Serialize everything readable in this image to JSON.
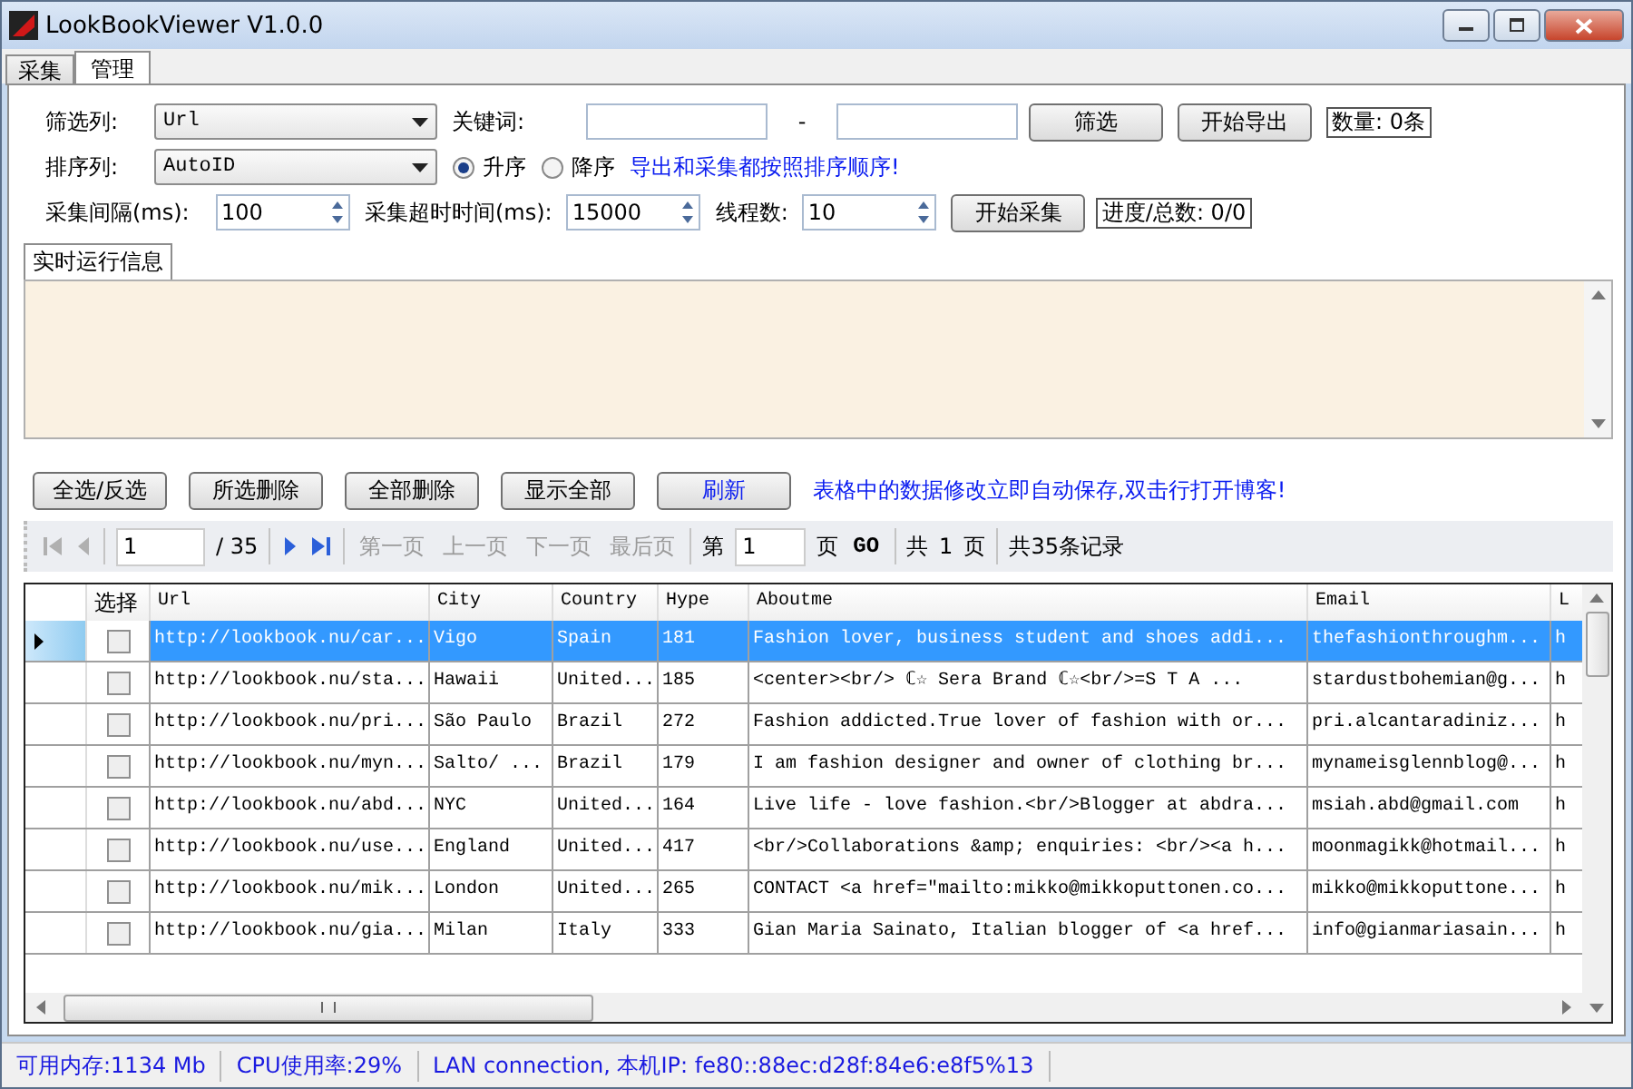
{
  "window": {
    "title": "LookBookViewer V1.0.0"
  },
  "tabs": [
    {
      "label": "采集",
      "selected": false
    },
    {
      "label": "管理",
      "selected": true
    }
  ],
  "filter": {
    "column_label": "筛选列:",
    "column_value": "Url",
    "keyword_label": "关键词:",
    "dash": "-",
    "filter_button": "筛选",
    "export_button": "开始导出",
    "count": "数量: 0条"
  },
  "sort": {
    "column_label": "排序列:",
    "column_value": "AutoID",
    "options": [
      {
        "label": "升序",
        "selected": true
      },
      {
        "label": "降序",
        "selected": false
      }
    ],
    "note": "导出和采集都按照排序顺序!"
  },
  "collect": {
    "interval_label": "采集间隔(ms):",
    "interval": "100",
    "timeout_label": "采集超时时间(ms):",
    "timeout": "15000",
    "threads_label": "线程数:",
    "threads": "10",
    "start_button": "开始采集",
    "progress": "进度/总数: 0/0"
  },
  "log": {
    "title": "实时运行信息"
  },
  "actions": {
    "buttons": [
      {
        "label": "全选/反选",
        "kind": "plain"
      },
      {
        "label": "所选删除",
        "kind": "plain"
      },
      {
        "label": "全部删除",
        "kind": "plain"
      },
      {
        "label": "显示全部",
        "kind": "plain"
      },
      {
        "label": "刷新",
        "kind": "accent"
      }
    ],
    "note": "表格中的数据修改立即自动保存,双击行打开博客!"
  },
  "pager": {
    "first_disabled": true,
    "prev_disabled": true,
    "page": "1",
    "total": "/ 35",
    "text_buttons": [
      {
        "label": "第一页",
        "disabled": true
      },
      {
        "label": "上一页",
        "disabled": true
      },
      {
        "label": "下一页",
        "disabled": true
      },
      {
        "label": "最后页",
        "disabled": true
      }
    ],
    "goto_prefix": "第",
    "goto_page": "1",
    "goto_suffix": "页",
    "go": "GO",
    "pages_prefix": "共",
    "pages": "1",
    "pages_suffix": "页",
    "records": "共35条记录"
  },
  "table": {
    "select_column": "选择",
    "columns": [
      "Url",
      "City",
      "Country",
      "Hype",
      "Aboutme",
      "Email",
      "L"
    ],
    "rows": [
      {
        "selected": true,
        "checked": false,
        "cells": [
          "http://lookbook.nu/car...",
          "Vigo",
          "Spain",
          "181",
          "Fashion lover, business student and shoes addi...",
          "thefashionthroughm...",
          "h"
        ]
      },
      {
        "selected": false,
        "checked": false,
        "cells": [
          "http://lookbook.nu/sta...",
          "Hawaii",
          "United...",
          "185",
          "<center><br/> ℂ☆ Sera Brand ℂ☆<br/>=S T A ...",
          "stardustbohemian@g...",
          "h"
        ]
      },
      {
        "selected": false,
        "checked": false,
        "cells": [
          "http://lookbook.nu/pri...",
          "São Paulo",
          "Brazil",
          "272",
          "Fashion addicted.True lover of fashion with or...",
          "pri.alcantaradiniz...",
          "h"
        ]
      },
      {
        "selected": false,
        "checked": false,
        "cells": [
          "http://lookbook.nu/myn...",
          "Salto/ ...",
          "Brazil",
          "179",
          "I am fashion designer and owner of clothing br...",
          "mynameisglennblog@...",
          "h"
        ]
      },
      {
        "selected": false,
        "checked": false,
        "cells": [
          "http://lookbook.nu/abd...",
          "NYC",
          "United...",
          "164",
          "Live life - love fashion.<br/>Blogger at abdra...",
          "msiah.abd@gmail.com",
          "h"
        ]
      },
      {
        "selected": false,
        "checked": false,
        "cells": [
          "http://lookbook.nu/use...",
          "England",
          "United...",
          "417",
          "<br/>Collaborations &amp; enquiries: <br/><a h...",
          "moonmagikk@hotmail...",
          "h"
        ]
      },
      {
        "selected": false,
        "checked": false,
        "cells": [
          "http://lookbook.nu/mik...",
          "London",
          "United...",
          "265",
          "CONTACT <a href=\"mailto:mikko@mikkoputtonen.co...",
          "mikko@mikkoputtone...",
          "h"
        ]
      },
      {
        "selected": false,
        "checked": false,
        "cells": [
          "http://lookbook.nu/gia...",
          "Milan",
          "Italy",
          "333",
          "Gian Maria Sainato, Italian blogger of <a href...",
          "info@gianmariasain...",
          "h"
        ]
      }
    ]
  },
  "status_bar": [
    "可用内存:1134 Mb",
    "CPU使用率:29%",
    "LAN connection, 本机IP: fe80::88ec:d28f:84e6:e8f5%13"
  ]
}
